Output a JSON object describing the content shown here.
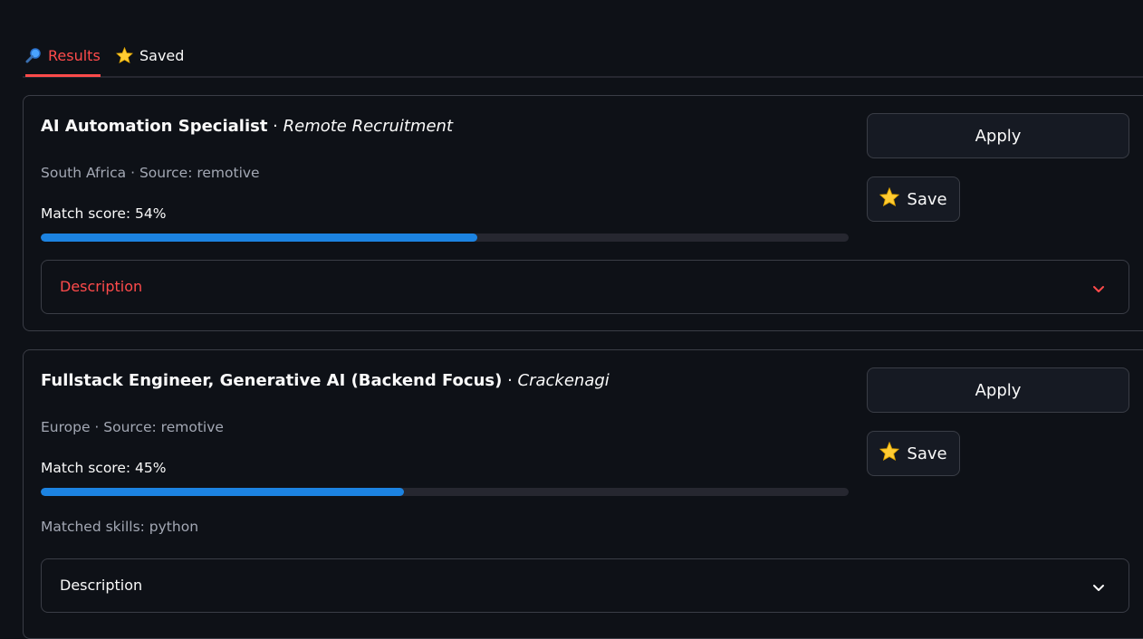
{
  "tabs": [
    {
      "label": "Results",
      "icon": "magnifier-icon",
      "active": true
    },
    {
      "label": "Saved",
      "icon": "star-icon",
      "active": false
    }
  ],
  "jobs": [
    {
      "title": "AI Automation Specialist",
      "separator": " · ",
      "company": "Remote Recruitment",
      "meta": "South Africa · Source: remotive",
      "score_label": "Match score: 54%",
      "score_fraction": 0.54,
      "matched_skills": "",
      "apply_label": "Apply",
      "save_label": "Save",
      "description_label": "Description"
    },
    {
      "title": "Fullstack Engineer, Generative AI (Backend Focus)",
      "separator": " · ",
      "company": "Crackenagi",
      "meta": "Europe · Source: remotive",
      "score_label": "Match score: 45%",
      "score_fraction": 0.45,
      "matched_skills": "Matched skills: python",
      "apply_label": "Apply",
      "save_label": "Save",
      "description_label": "Description"
    }
  ],
  "colors": {
    "background": "#0e1117",
    "accent": "#ff4b4b",
    "progress": "#1c83e1",
    "star": "#ffcc33"
  }
}
